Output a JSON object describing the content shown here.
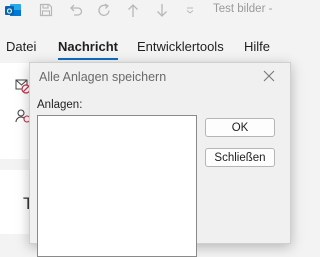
{
  "titlebar": {
    "title": "Test bilder  -",
    "quick_access": [
      {
        "icon": "save-icon",
        "glyph": "🖫"
      },
      {
        "icon": "undo-icon",
        "glyph": "↶"
      },
      {
        "icon": "redo-icon",
        "glyph": "↻"
      },
      {
        "icon": "arrow-up-icon",
        "glyph": "↑"
      },
      {
        "icon": "arrow-down-icon",
        "glyph": "↓"
      },
      {
        "icon": "customize-dropdown-icon",
        "glyph": "⌄"
      }
    ]
  },
  "ribbon": {
    "tabs": [
      {
        "label": "Datei"
      },
      {
        "label": "Nachricht",
        "active": true
      },
      {
        "label": "Entwicklertools"
      },
      {
        "label": "Hilfe"
      }
    ]
  },
  "background": {
    "icons": [
      "ignore-message-icon",
      "contacts-icon"
    ],
    "partial_letter": "T"
  },
  "dialog": {
    "title": "Alle Anlagen speichern",
    "attachments_label": "Anlagen:",
    "attachments": [],
    "ok_label": "OK",
    "close_label": "Schließen"
  },
  "colors": {
    "accent": "#0f6cbd",
    "outlook_blue": "#0a64ad"
  }
}
